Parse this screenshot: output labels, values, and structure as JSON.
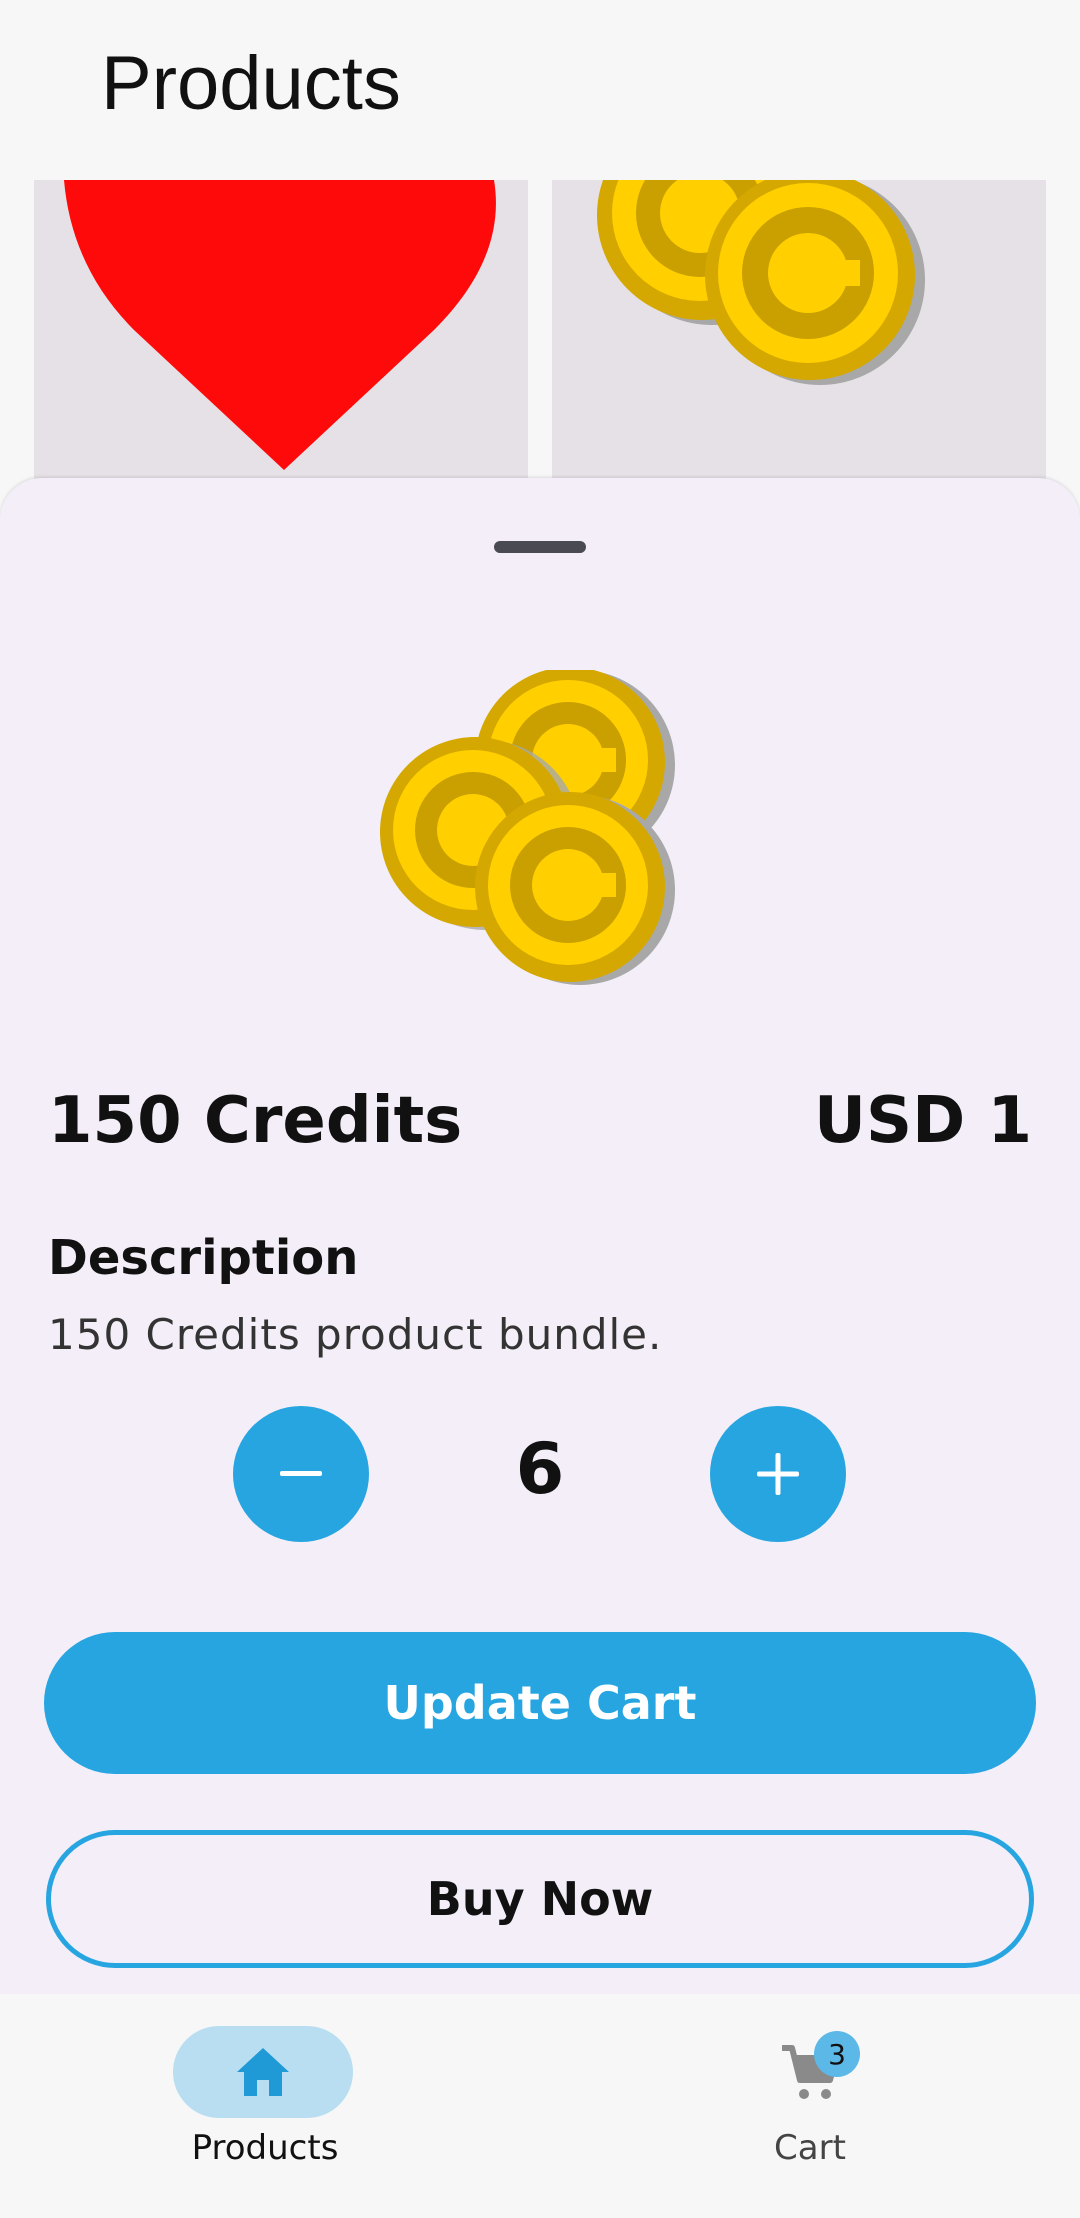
{
  "header": {
    "title": "Products"
  },
  "product": {
    "name": "150 Credits",
    "price": "USD 1",
    "description_heading": "Description",
    "description": "150 Credits product bundle.",
    "image_icon": "coins-icon"
  },
  "quantity": {
    "value": "6",
    "decrement_icon": "minus-icon",
    "increment_icon": "plus-icon"
  },
  "actions": {
    "update_cart_label": "Update Cart",
    "buy_now_label": "Buy Now"
  },
  "bottom_nav": {
    "items": [
      {
        "label": "Products",
        "icon": "home-icon",
        "selected": true
      },
      {
        "label": "Cart",
        "icon": "cart-icon",
        "badge": "3"
      }
    ]
  },
  "colors": {
    "accent": "#27a5e1",
    "sheet_background": "#f3eef7",
    "nav_pill": "#b9def1",
    "heart": "#ff0a0a",
    "coin": "#ffcf00"
  }
}
